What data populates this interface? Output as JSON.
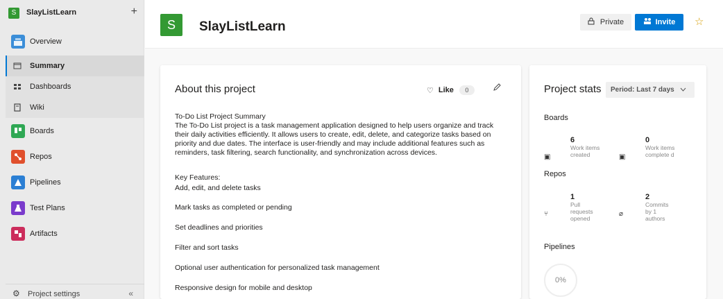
{
  "sidebar": {
    "project_badge": "S",
    "project_name": "SlayListLearn",
    "add_label": "+",
    "items": [
      {
        "label": "Overview",
        "icon": "overview-icon",
        "color": "#3b8ed8"
      },
      {
        "label": "Summary",
        "icon": "summary-icon"
      },
      {
        "label": "Dashboards",
        "icon": "dashboards-icon"
      },
      {
        "label": "Wiki",
        "icon": "wiki-icon"
      },
      {
        "label": "Boards",
        "icon": "boards-icon",
        "color": "#2fa854"
      },
      {
        "label": "Repos",
        "icon": "repos-icon",
        "color": "#e0502d"
      },
      {
        "label": "Pipelines",
        "icon": "pipelines-icon",
        "color": "#2b7fd4"
      },
      {
        "label": "Test Plans",
        "icon": "test-plans-icon",
        "color": "#7a3bcc"
      },
      {
        "label": "Artifacts",
        "icon": "artifacts-icon",
        "color": "#cc2d5c"
      }
    ],
    "footer": {
      "label": "Project settings",
      "collapse": "«"
    }
  },
  "header": {
    "badge": "S",
    "title": "SlayListLearn",
    "private_label": "Private",
    "invite_label": "Invite",
    "star": "☆"
  },
  "about": {
    "title": "About this project",
    "like_label": "Like",
    "like_count": "0",
    "summary_title": "To-Do List Project Summary",
    "summary_body": "The To-Do List project is a task management application designed to help users organize and track their daily activities efficiently. It allows users to create, edit, delete, and categorize tasks based on priority and due dates. The interface is user-friendly and may include additional features such as reminders, task filtering, search functionality, and synchronization across devices.",
    "features_heading": "Key Features:",
    "features": [
      "Add, edit, and delete tasks",
      "Mark tasks as completed or pending",
      "Set deadlines and priorities",
      "Filter and sort tasks",
      "Optional user authentication for personalized task management",
      "Responsive design for mobile and desktop"
    ]
  },
  "stats": {
    "title": "Project stats",
    "period_label": "Period: Last 7 days",
    "boards_label": "Boards",
    "boards": [
      {
        "value": "6",
        "desc": "Work items created"
      },
      {
        "value": "0",
        "desc": "Work items complete d"
      }
    ],
    "repos_label": "Repos",
    "repos": [
      {
        "value": "1",
        "desc": "Pull requests opened"
      },
      {
        "value": "2",
        "desc": "Commits by 1 authors"
      }
    ],
    "pipelines_label": "Pipelines",
    "pipelines_value": "0%"
  }
}
